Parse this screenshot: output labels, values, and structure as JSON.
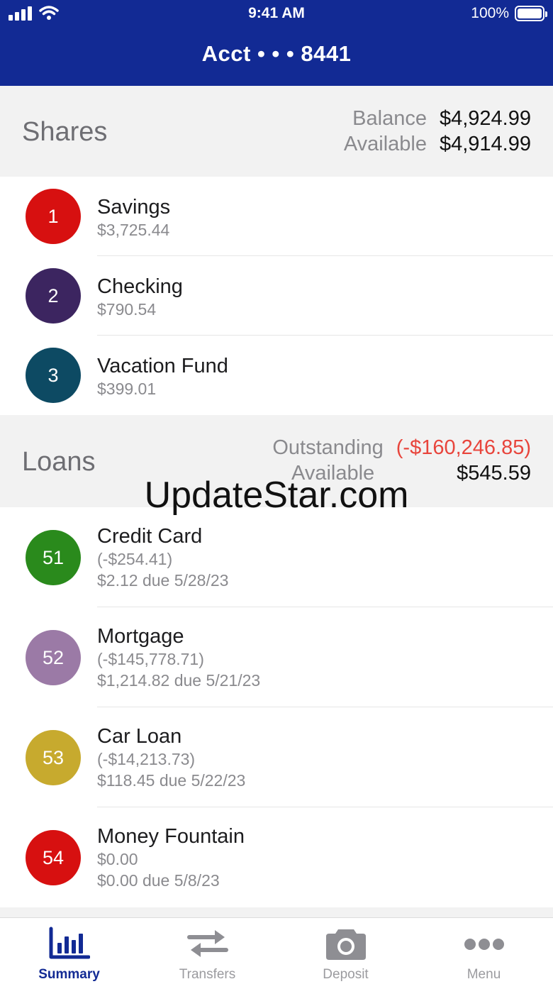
{
  "status": {
    "time": "9:41 AM",
    "battery": "100%"
  },
  "header": {
    "title": "Acct • • • 8441"
  },
  "shares": {
    "title": "Shares",
    "balance_label": "Balance",
    "balance_value": "$4,924.99",
    "available_label": "Available",
    "available_value": "$4,914.99",
    "items": [
      {
        "number": "1",
        "name": "Savings",
        "amount": "$3,725.44",
        "color": "#d71010"
      },
      {
        "number": "2",
        "name": "Checking",
        "amount": "$790.54",
        "color": "#3c2560"
      },
      {
        "number": "3",
        "name": "Vacation Fund",
        "amount": "$399.01",
        "color": "#0d4a63"
      }
    ]
  },
  "loans": {
    "title": "Loans",
    "outstanding_label": "Outstanding",
    "outstanding_value": "(-$160,246.85)",
    "available_label": "Available",
    "available_value": "$545.59",
    "items": [
      {
        "number": "51",
        "name": "Credit Card",
        "balance": "(-$254.41)",
        "due": "$2.12 due 5/28/23",
        "color": "#2a8a1c"
      },
      {
        "number": "52",
        "name": "Mortgage",
        "balance": "(-$145,778.71)",
        "due": "$1,214.82 due 5/21/23",
        "color": "#9b7aa6"
      },
      {
        "number": "53",
        "name": "Car Loan",
        "balance": "(-$14,213.73)",
        "due": "$118.45 due 5/22/23",
        "color": "#c7aa2e"
      },
      {
        "number": "54",
        "name": "Money Fountain",
        "balance": "$0.00",
        "due": "$0.00 due 5/8/23",
        "color": "#d71010"
      }
    ]
  },
  "watermark": "UpdateStar.com",
  "tabs": [
    {
      "label": "Summary",
      "icon": "bar-chart-icon",
      "active": true
    },
    {
      "label": "Transfers",
      "icon": "transfer-arrows-icon",
      "active": false
    },
    {
      "label": "Deposit",
      "icon": "camera-icon",
      "active": false
    },
    {
      "label": "Menu",
      "icon": "more-dots-icon",
      "active": false
    }
  ],
  "colors": {
    "brand": "#122a94",
    "negative": "#e8453c"
  }
}
